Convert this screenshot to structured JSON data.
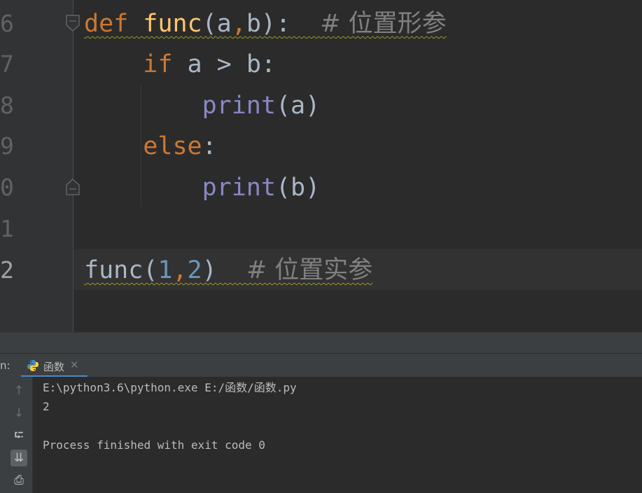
{
  "editor": {
    "line_numbers": [
      "6",
      "7",
      "8",
      "9",
      "0",
      "1",
      "2"
    ],
    "lines": {
      "l6": {
        "kw": "def",
        "fn": "func",
        "open": "(",
        "a": "a",
        "comma": ",",
        "b": "b",
        "close": "):",
        "comment": "# 位置形参"
      },
      "l7": {
        "kw": "if",
        "rest": "a > b:"
      },
      "l8": {
        "bi": "print",
        "rest": "(a)"
      },
      "l9": {
        "kw": "else",
        "rest": ":"
      },
      "l10": {
        "bi": "print",
        "rest": "(b)"
      },
      "l12": {
        "fn": "func",
        "open": "(",
        "n1": "1",
        "comma": ",",
        "n2": "2",
        "close": ")",
        "comment": "# 位置实参"
      }
    }
  },
  "run_panel": {
    "label": "n:",
    "tab": {
      "name": "函数",
      "close": "✕",
      "icon": "python-icon"
    },
    "toolbar": {
      "up": "↑",
      "down": "↓",
      "wrap": "⮓",
      "scroll_end": "⇊",
      "print": "⎙"
    },
    "output": [
      "E:\\python3.6\\python.exe E:/函数/函数.py",
      "2",
      "",
      "Process finished with exit code 0"
    ]
  },
  "colors": {
    "keyword": "#cc7832",
    "function": "#ffc66d",
    "builtin": "#8888c6",
    "number": "#6897bb",
    "comment": "#808080",
    "accent": "#4a88c7"
  }
}
